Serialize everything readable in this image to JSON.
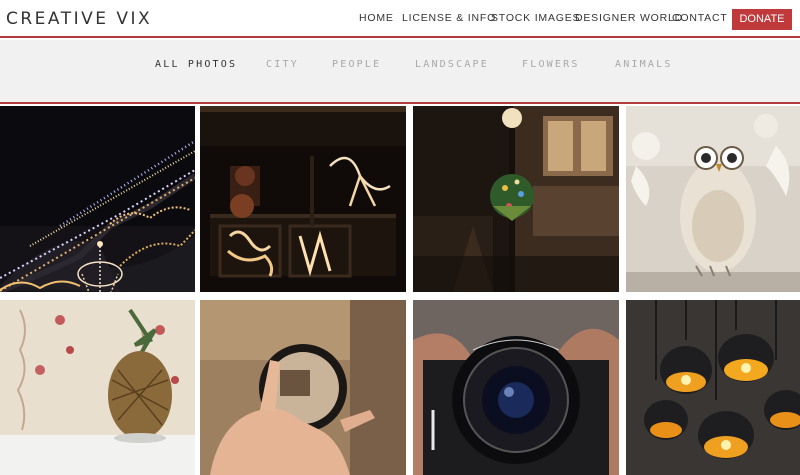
{
  "header": {
    "logo": "CREATIVE VIX",
    "nav": [
      "HOME",
      "LICENSE & INFO",
      "STOCK IMAGES",
      "DESIGNER WORLD",
      "CONTACT"
    ],
    "donate_label": "DONATE",
    "accent_color": "#c0393b"
  },
  "filters": {
    "items": [
      "ALL PHOTOS",
      "CITY",
      "PEOPLE",
      "LANDSCAPE",
      "FLOWERS",
      "ANIMALS"
    ],
    "active": "ALL PHOTOS"
  },
  "gallery": {
    "photos": [
      {
        "subject": "christmas-lights-street"
      },
      {
        "subject": "window-lights-night"
      },
      {
        "subject": "lamp-post-wreath"
      },
      {
        "subject": "owl-figurine"
      },
      {
        "subject": "pineapple"
      },
      {
        "subject": "hand-holding-lens"
      },
      {
        "subject": "canon-camera-lens"
      },
      {
        "subject": "hanging-lamps"
      }
    ]
  }
}
